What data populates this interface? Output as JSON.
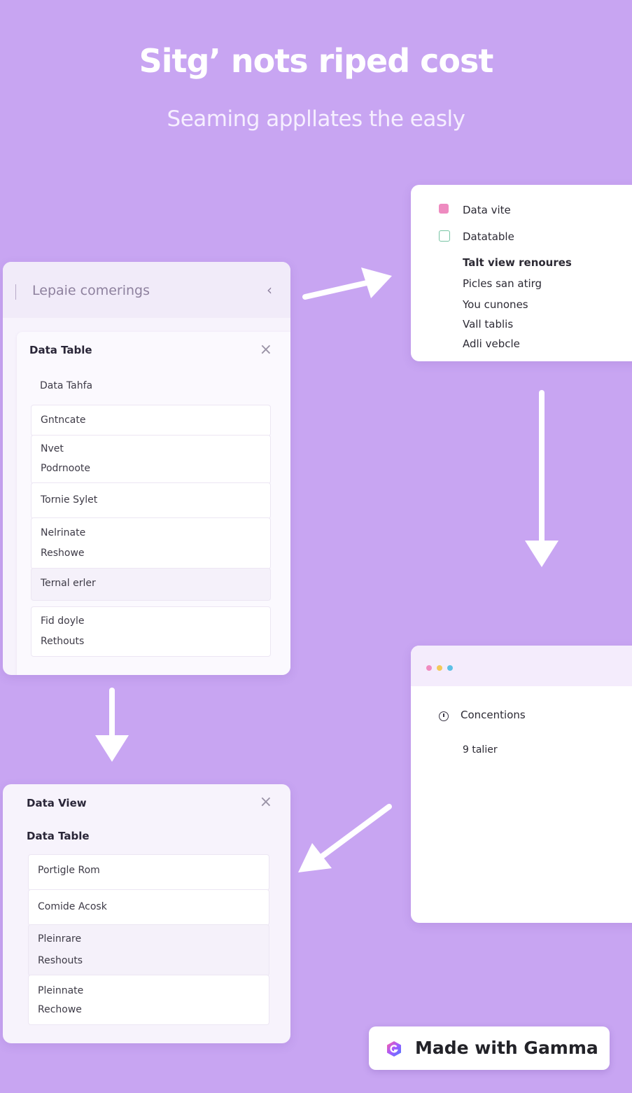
{
  "hero": {
    "title": "Sitg’ nots riped cost",
    "subtitle": "Seaming appllates the easly"
  },
  "left_panel": {
    "search_placeholder": "Lepaie comerings",
    "card_title": "Data Table",
    "first_row": "Data Tahfa",
    "rows": [
      {
        "lines": [
          "Gntncate"
        ]
      },
      {
        "lines": [
          "Nvet",
          "Podrnoote"
        ]
      },
      {
        "lines": [
          "Tornie Sylet"
        ]
      },
      {
        "lines": [
          "Nelrinate",
          "Reshowe"
        ]
      },
      {
        "lines": [
          "Ternal erler"
        ]
      },
      {
        "lines": [
          "Fid doyle",
          "Rethouts"
        ]
      }
    ]
  },
  "right_top_panel": {
    "checkbox_items": [
      "Data vite",
      "Datatable"
    ],
    "bold_item": "Talt view renoures",
    "items": [
      "Picles san atirg",
      "You cunones",
      "Vall tablis",
      "Adli vebcle"
    ]
  },
  "right_bottom_panel": {
    "window_dots": [
      "#f08bc0",
      "#f3c95a",
      "#5cc0e6"
    ],
    "item_label": "Concentions",
    "sub_label": "9 talier"
  },
  "bottom_panel": {
    "title": "Data View",
    "subtitle": "Data Table",
    "rows": [
      {
        "lines": [
          "Portigle Rom"
        ]
      },
      {
        "lines": [
          "Comide Acosk"
        ]
      },
      {
        "lines": [
          "Pleinrare",
          "Reshouts"
        ]
      },
      {
        "lines": [
          "Pleinnate",
          "Rechowe"
        ]
      }
    ]
  },
  "icons": {
    "back": "chevron-left-icon",
    "close": "close-icon",
    "clock": "clock-icon",
    "arrow": "arrow-icon",
    "logo": "gamma-logo-icon"
  },
  "colors": {
    "background": "#c8a5f2",
    "arrow": "#ffffff",
    "accent_pink": "#ee8bc0",
    "accent_green": "#78c4a4"
  },
  "badge": {
    "text": "Made with Gamma"
  }
}
